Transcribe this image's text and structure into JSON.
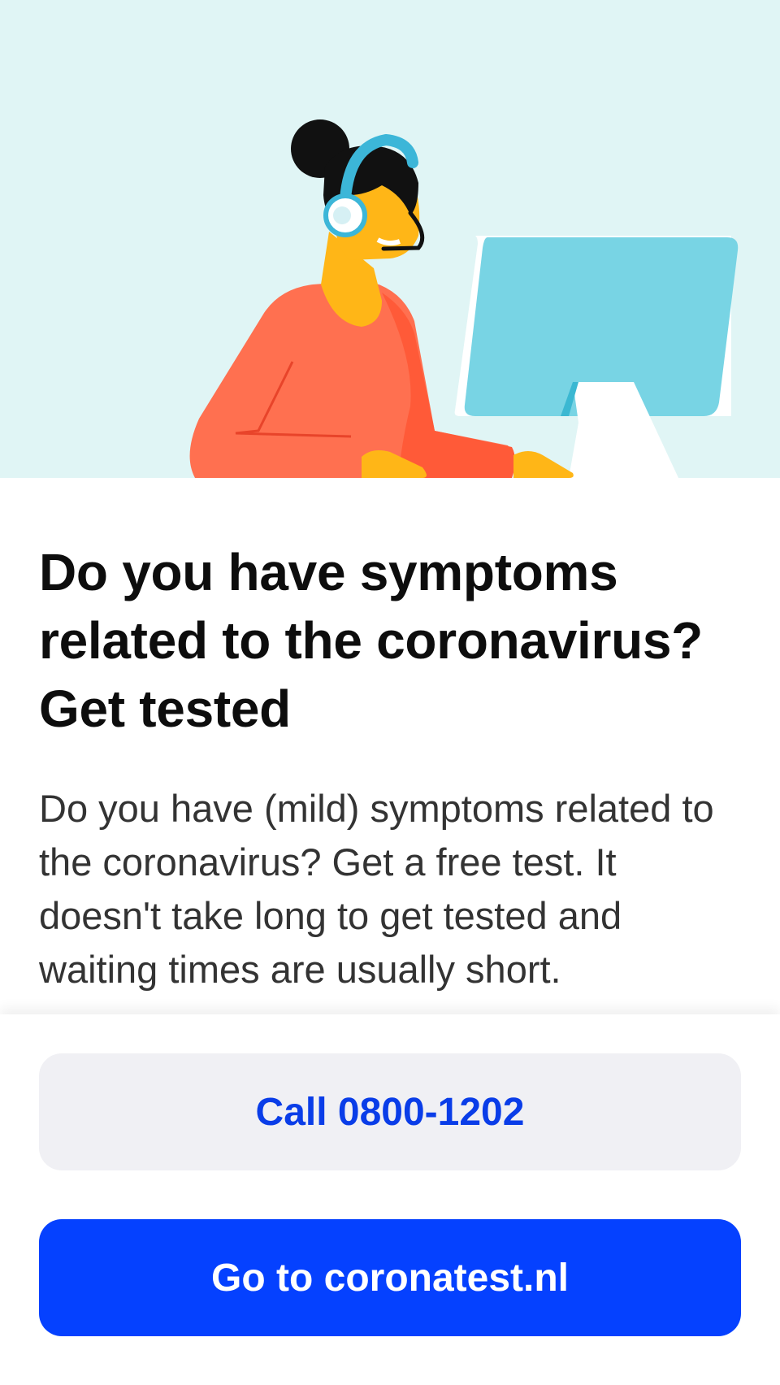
{
  "hero": {
    "illustration": "call-center-agent-with-headset-at-computer"
  },
  "main": {
    "title": "Do you have symptoms related to the coronavirus? Get tested",
    "body": "Do you have (mild) symptoms related to the coronavirus? Get a free test. It doesn't take long to get tested and waiting times are usually short."
  },
  "actions": {
    "call_label": "Call 0800-1202",
    "website_label": "Go to coronatest.nl"
  },
  "colors": {
    "hero_background": "#e0f5f5",
    "primary": "#0541ff",
    "secondary_button": "#f0f0f4",
    "secondary_text": "#0a3de8",
    "title": "#0d0d0d",
    "body": "#333333"
  }
}
